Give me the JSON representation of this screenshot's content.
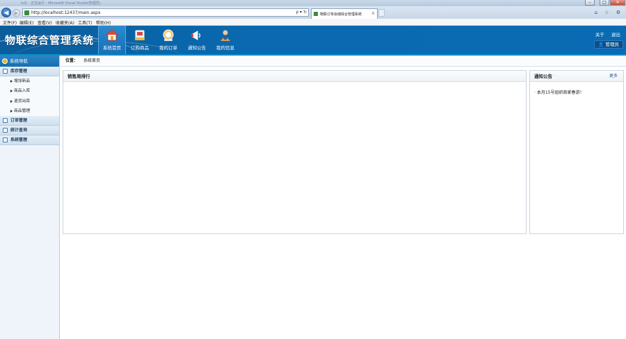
{
  "browser": {
    "window_title": "ioI1 - 正在运行 - Microsoft Visual Studio(管理员)",
    "url": "http://localhost:12437/main.aspx",
    "address_tools": "ρ ▾ ↻",
    "tab_title": "物联订单会储综合管理系统",
    "tab_close": "×",
    "window_controls": {
      "minimize": "–",
      "maximize": "□",
      "close": "✕"
    },
    "right_icons": "⌂ ☆ ⚙"
  },
  "menubar": [
    "文件(F)",
    "编辑(E)",
    "查看(V)",
    "收藏夹(A)",
    "工具(T)",
    "帮助(H)"
  ],
  "header": {
    "app_title": "物联综合管理系统",
    "nav": [
      {
        "label": "系统首页",
        "icon": "home-icon",
        "active": true
      },
      {
        "label": "订购商品",
        "icon": "order-goods-icon",
        "active": false
      },
      {
        "label": "我的订单",
        "icon": "my-orders-icon",
        "active": false
      },
      {
        "label": "通知公告",
        "icon": "megaphone-icon",
        "active": false
      },
      {
        "label": "我的信息",
        "icon": "user-profile-icon",
        "active": false
      }
    ],
    "links": {
      "about": "关于",
      "logout": "退出"
    },
    "user_badge": "管理员"
  },
  "sidebar": {
    "title": "系统导航",
    "groups": [
      {
        "label": "库存管理",
        "items": [
          "增加新品",
          "商品入库",
          "退货出库",
          "商品管理"
        ]
      },
      {
        "label": "订单管理",
        "items": []
      },
      {
        "label": "统计查询",
        "items": []
      },
      {
        "label": "系统管理",
        "items": []
      }
    ]
  },
  "breadcrumb": {
    "label": "位置：",
    "current": "系统首页"
  },
  "sales_panel": {
    "title": "销售周排行"
  },
  "notice_panel": {
    "title": "通知公告",
    "more": "更多",
    "items": [
      "本月15号组织商家春游！"
    ]
  },
  "colors": {
    "header_blue": "#0a69b0",
    "active_nav": "#1f80c6",
    "sidebar_bg": "#eef4f9"
  }
}
